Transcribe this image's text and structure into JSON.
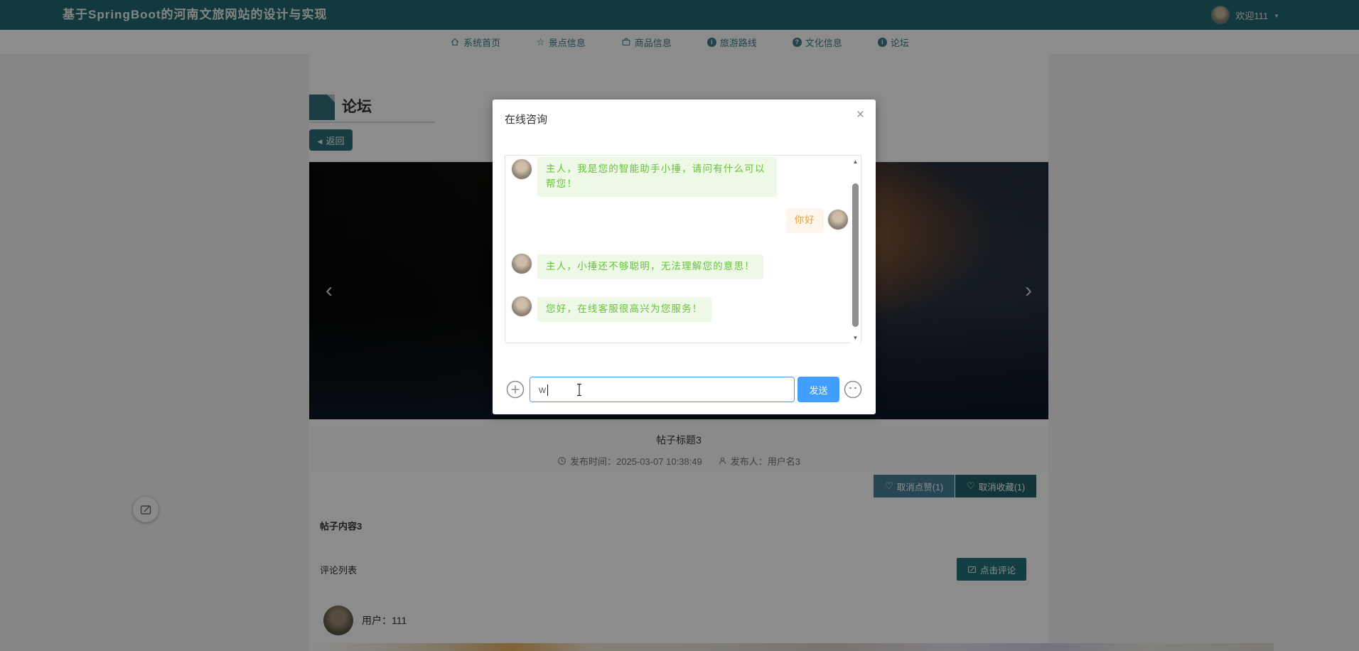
{
  "colors": {
    "header_bg": "#226b72",
    "accent_teal": "#267379",
    "like_button_bg": "#47809a",
    "favorite_button_bg": "#226169",
    "primary_blue": "#409eff",
    "bot_bubble_bg": "#edf8e6",
    "bot_text": "#67c23a",
    "user_bubble_bg": "#fdf6ec",
    "user_text": "#e6a23c"
  },
  "header": {
    "title": "基于SpringBoot的河南文旅网站的设计与实现",
    "welcome": "欢迎111",
    "avatar_icon": "user-avatar",
    "caret_icon": "chevron-down-icon"
  },
  "nav": {
    "items": [
      {
        "label": "系统首页",
        "icon": "home-icon"
      },
      {
        "label": "景点信息",
        "icon": "star-icon"
      },
      {
        "label": "商品信息",
        "icon": "briefcase-icon"
      },
      {
        "label": "旅游路线",
        "icon": "info-circle-icon"
      },
      {
        "label": "文化信息",
        "icon": "question-circle-icon"
      },
      {
        "label": "论坛",
        "icon": "info-circle-icon"
      }
    ]
  },
  "forum": {
    "page_title": "论坛",
    "back_label": "返回",
    "carousel": {
      "prev_icon": "chevron-left-icon",
      "next_icon": "chevron-right-icon"
    },
    "post": {
      "title": "帖子标题3",
      "time_icon": "clock-icon",
      "time_text": "发布时间：2025-03-07 10:38:49",
      "publisher_icon": "person-icon",
      "publisher_text": "发布人：用户名3",
      "unlike_label": "取消点赞(1)",
      "unfavorite_label": "取消收藏(1)",
      "heart_icon": "heart-outline-icon",
      "content": "帖子内容3"
    },
    "comments": {
      "header": "评论列表",
      "comment_button": "点击评论",
      "comment_button_icon": "edit-pencil-icon",
      "items": [
        {
          "user": "用户：111"
        }
      ]
    }
  },
  "launcher": {
    "icon": "compose-chat-icon"
  },
  "chat_modal": {
    "title": "在线咨询",
    "close_icon": "close-icon",
    "messages": [
      {
        "role": "bot",
        "text": "主人，我是您的智能助手小捶，请问有什么可以帮您！"
      },
      {
        "role": "user",
        "text": "你好"
      },
      {
        "role": "bot",
        "text": "主人，小捶还不够聪明，无法理解您的意思！"
      },
      {
        "role": "bot",
        "text": "您好，在线客服很高兴为您服务！"
      }
    ],
    "scrollbar": {
      "up_icon": "scroll-up-icon",
      "down_icon": "scroll-down-icon"
    },
    "input": {
      "value": "w"
    },
    "send_label": "发送",
    "plus_icon": "plus-circle-icon",
    "emoji_icon": "smiley-icon"
  }
}
